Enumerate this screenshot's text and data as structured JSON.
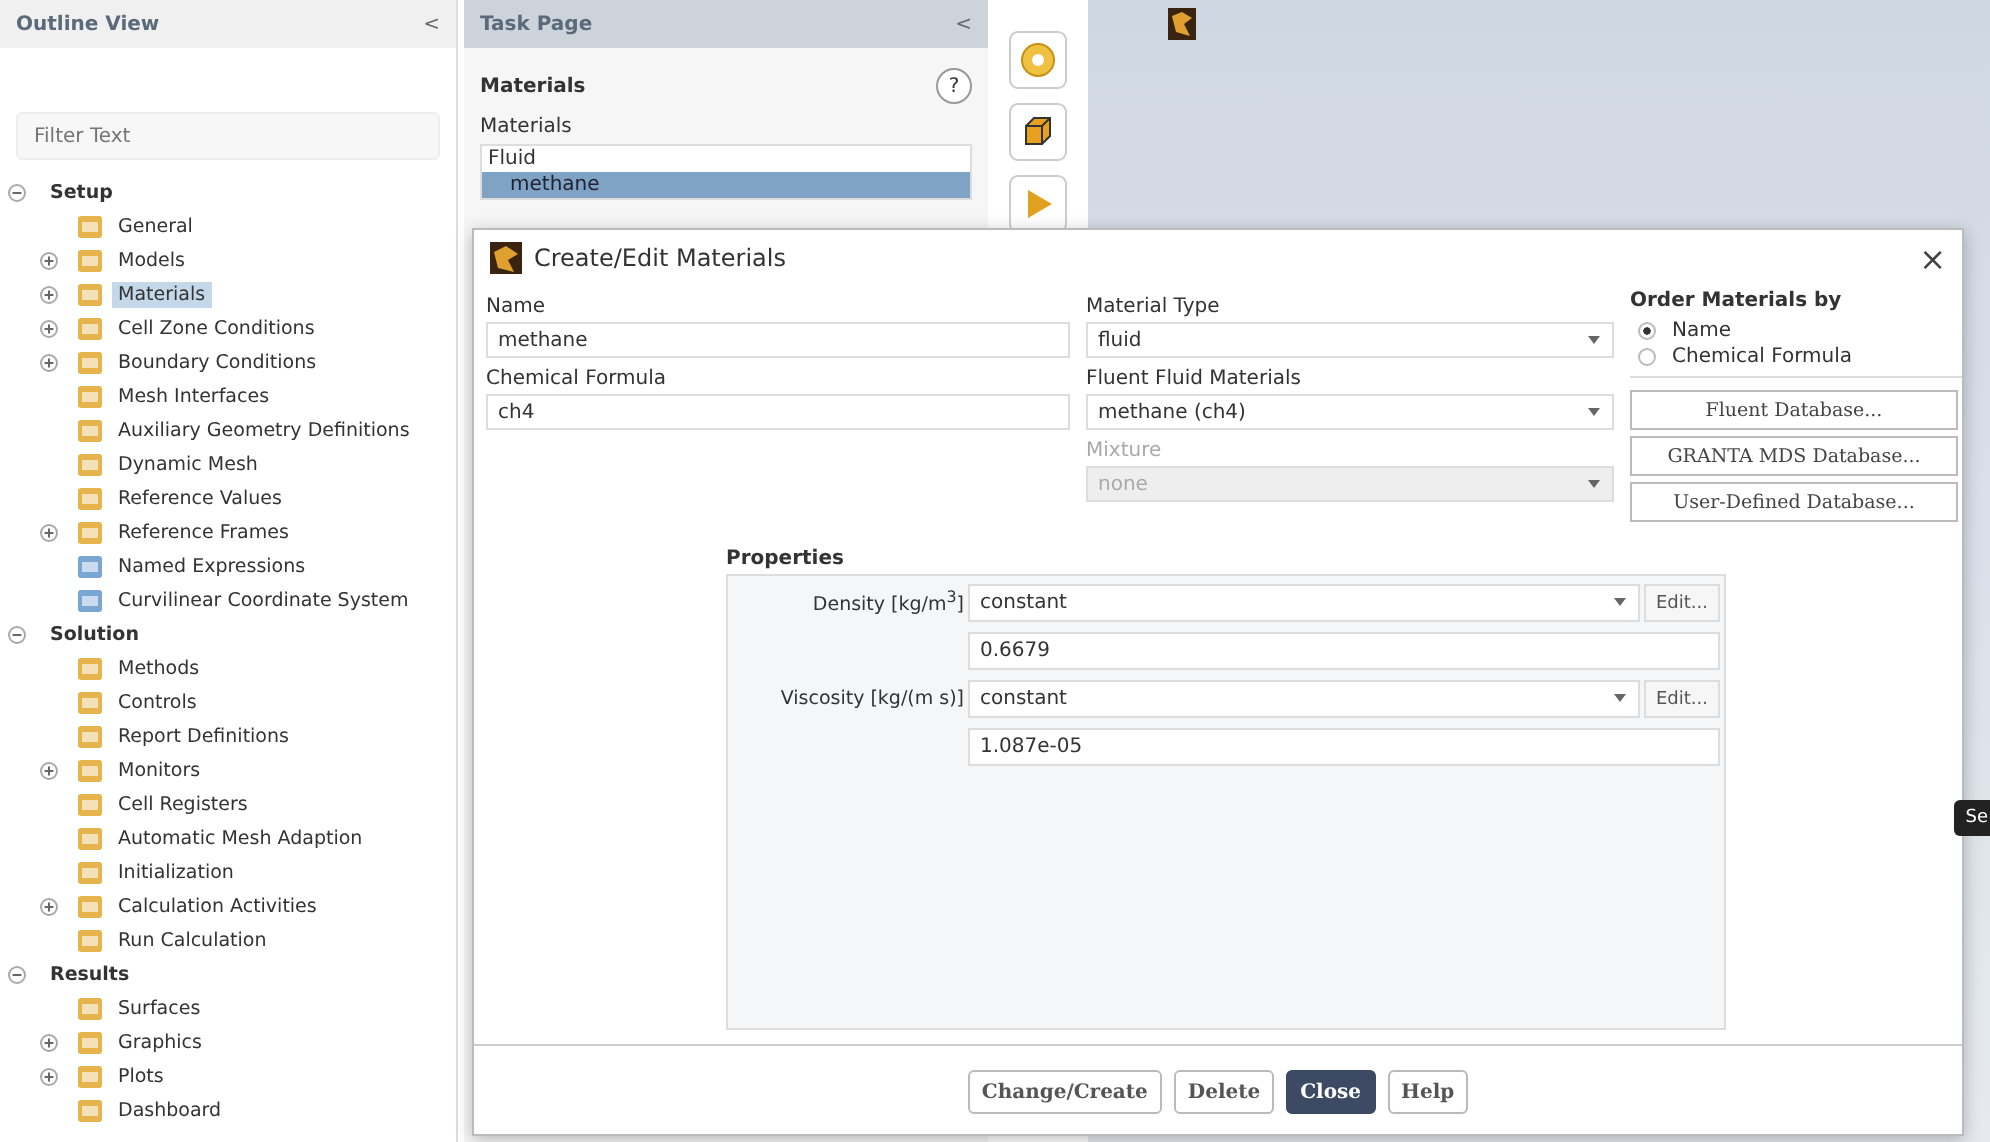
{
  "outline": {
    "title": "Outline View",
    "collapse": "<",
    "filter": {
      "placeholder": "Filter Text"
    },
    "tree": [
      {
        "label": "Setup",
        "expanded": true,
        "selected": false,
        "children": [
          {
            "label": "General",
            "selected": false
          },
          {
            "label": "Models",
            "expanded": false,
            "selected": false
          },
          {
            "label": "Materials",
            "expanded": false,
            "selected": true
          },
          {
            "label": "Cell Zone Conditions",
            "expanded": false,
            "selected": false
          },
          {
            "label": "Boundary Conditions",
            "expanded": false,
            "selected": false
          },
          {
            "label": "Mesh Interfaces",
            "selected": false
          },
          {
            "label": "Auxiliary Geometry Definitions",
            "selected": false
          },
          {
            "label": "Dynamic Mesh",
            "selected": false
          },
          {
            "label": "Reference Values",
            "selected": false
          },
          {
            "label": "Reference Frames",
            "expanded": false,
            "selected": false
          },
          {
            "label": "Named Expressions",
            "selected": false
          },
          {
            "label": "Curvilinear Coordinate System",
            "selected": false
          }
        ]
      },
      {
        "label": "Solution",
        "expanded": true,
        "selected": false,
        "children": [
          {
            "label": "Methods",
            "selected": false
          },
          {
            "label": "Controls",
            "selected": false
          },
          {
            "label": "Report Definitions",
            "selected": false
          },
          {
            "label": "Monitors",
            "expanded": false,
            "selected": false
          },
          {
            "label": "Cell Registers",
            "selected": false
          },
          {
            "label": "Automatic Mesh Adaption",
            "selected": false
          },
          {
            "label": "Initialization",
            "selected": false
          },
          {
            "label": "Calculation Activities",
            "expanded": false,
            "selected": false
          },
          {
            "label": "Run Calculation",
            "selected": false
          }
        ]
      },
      {
        "label": "Results",
        "expanded": true,
        "selected": false,
        "children": [
          {
            "label": "Surfaces",
            "selected": false
          },
          {
            "label": "Graphics",
            "expanded": false,
            "selected": false
          },
          {
            "label": "Plots",
            "expanded": false,
            "selected": false
          },
          {
            "label": "Dashboard",
            "selected": false
          }
        ]
      }
    ]
  },
  "task_page": {
    "title": "Task Page",
    "collapse": "<",
    "heading": "Materials",
    "help_symbol": "?",
    "list_label": "Materials",
    "list": [
      {
        "label": "Fluid",
        "selected": false
      },
      {
        "label": "methane",
        "selected": true
      }
    ]
  },
  "graphics": {
    "side_tab": "Se"
  },
  "dialog": {
    "title": "Create/Edit Materials",
    "close": "×",
    "name": {
      "label": "Name",
      "value": "methane"
    },
    "formula": {
      "label": "Chemical Formula",
      "value": "ch4"
    },
    "material_type": {
      "label": "Material Type",
      "value": "fluid",
      "disabled": false
    },
    "fluent_materials": {
      "label": "Fluent Fluid Materials",
      "value": "methane (ch4)",
      "disabled": false
    },
    "mixture": {
      "label": "Mixture",
      "value": "none",
      "disabled": true
    },
    "order": {
      "title": "Order Materials by",
      "options": [
        {
          "label": "Name",
          "selected": true
        },
        {
          "label": "Chemical Formula",
          "selected": false
        }
      ]
    },
    "databases": [
      "Fluent Database...",
      "GRANTA MDS Database...",
      "User-Defined Database..."
    ],
    "properties": {
      "title": "Properties",
      "rows": [
        {
          "label": "Density [kg/m$^{3}$]",
          "method": "constant",
          "edit": "Edit...",
          "value": "0.6679"
        },
        {
          "label": "Viscosity [kg/(m s)]",
          "method": "constant",
          "edit": "Edit...",
          "value": "1.087e-05"
        }
      ]
    },
    "buttons": [
      {
        "label": "Change/Create",
        "kind": "normal"
      },
      {
        "label": "Delete",
        "kind": "normal"
      },
      {
        "label": "Close",
        "kind": "default"
      },
      {
        "label": "Help",
        "kind": "normal"
      }
    ]
  }
}
